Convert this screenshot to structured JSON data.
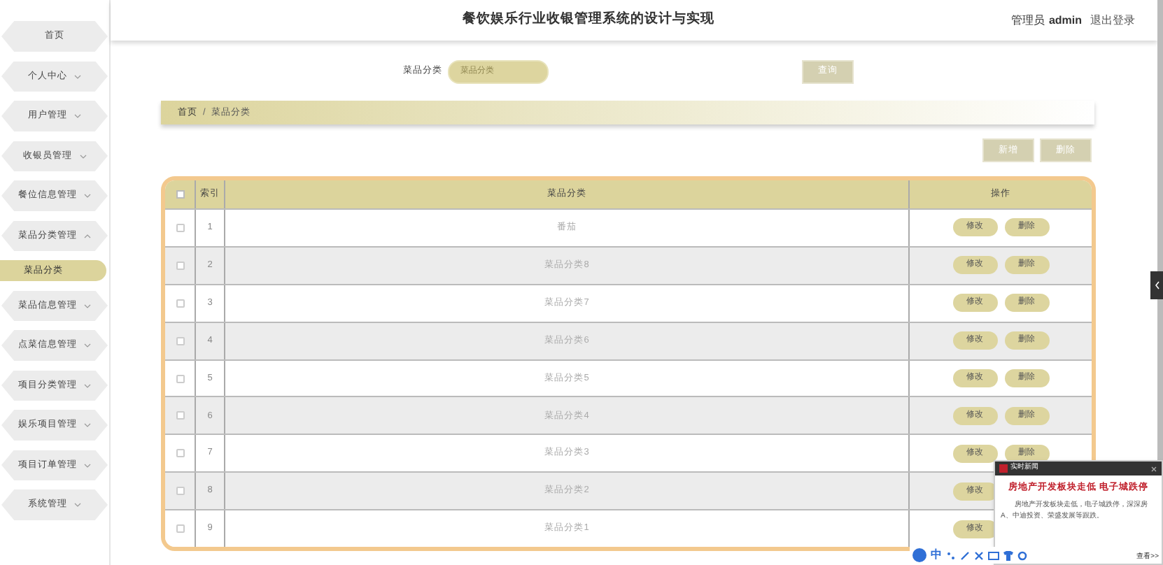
{
  "header": {
    "title": "餐饮娱乐行业收银管理系统的设计与实现",
    "role": "管理员",
    "username": "admin",
    "logout": "退出登录"
  },
  "sidebar": {
    "items": [
      {
        "label": "首页",
        "kind": "link",
        "selected": false
      },
      {
        "label": "个人中心",
        "kind": "menu",
        "selected": false,
        "expanded": false
      },
      {
        "label": "用户管理",
        "kind": "menu",
        "selected": false,
        "expanded": false
      },
      {
        "label": "收银员管理",
        "kind": "menu",
        "selected": false,
        "expanded": false
      },
      {
        "label": "餐位信息管理",
        "kind": "menu",
        "selected": false,
        "expanded": false
      },
      {
        "label": "菜品分类管理",
        "kind": "menu",
        "selected": false,
        "expanded": true,
        "children": [
          {
            "label": "菜品分类",
            "selected": true
          }
        ]
      },
      {
        "label": "菜品信息管理",
        "kind": "menu",
        "selected": false,
        "expanded": false
      },
      {
        "label": "点菜信息管理",
        "kind": "menu",
        "selected": false,
        "expanded": false
      },
      {
        "label": "项目分类管理",
        "kind": "menu",
        "selected": false,
        "expanded": false
      },
      {
        "label": "娱乐项目管理",
        "kind": "menu",
        "selected": false,
        "expanded": false
      },
      {
        "label": "项目订单管理",
        "kind": "menu",
        "selected": false,
        "expanded": false
      },
      {
        "label": "系统管理",
        "kind": "menu",
        "selected": false,
        "expanded": false
      }
    ]
  },
  "search": {
    "label": "菜品分类",
    "placeholder": "菜品分类",
    "button": "查询"
  },
  "breadcrumb": {
    "items": [
      "首页",
      "菜品分类"
    ],
    "separator": "/"
  },
  "actions": [
    "新增",
    "删除"
  ],
  "table": {
    "select_all_checked": false,
    "columns": [
      "索引",
      "菜品分类",
      "操作"
    ],
    "rows": [
      {
        "checked": false,
        "index": "1",
        "category": "番茄",
        "actions": [
          "修改",
          "删除"
        ]
      },
      {
        "checked": false,
        "index": "2",
        "category": "菜品分类8",
        "actions": [
          "修改",
          "删除"
        ]
      },
      {
        "checked": false,
        "index": "3",
        "category": "菜品分类7",
        "actions": [
          "修改",
          "删除"
        ]
      },
      {
        "checked": false,
        "index": "4",
        "category": "菜品分类6",
        "actions": [
          "修改",
          "删除"
        ]
      },
      {
        "checked": false,
        "index": "5",
        "category": "菜品分类5",
        "actions": [
          "修改",
          "删除"
        ]
      },
      {
        "checked": false,
        "index": "6",
        "category": "菜品分类4",
        "actions": [
          "修改",
          "删除"
        ]
      },
      {
        "checked": false,
        "index": "7",
        "category": "菜品分类3",
        "actions": [
          "修改",
          "删除"
        ]
      },
      {
        "checked": false,
        "index": "8",
        "category": "菜品分类2",
        "actions": [
          "修改"
        ]
      },
      {
        "checked": false,
        "index": "9",
        "category": "菜品分类1",
        "actions": [
          "修改"
        ]
      }
    ]
  },
  "notification": {
    "header": "实时新闻",
    "headline": "房地产开发板块走低 电子城跌停",
    "body": "房地产开发板块走低，电子城跌停，深深房A、中迪投资、荣盛发展等跟跌。",
    "link": "查看>>"
  },
  "ime_bar": {
    "mode": "中"
  }
}
